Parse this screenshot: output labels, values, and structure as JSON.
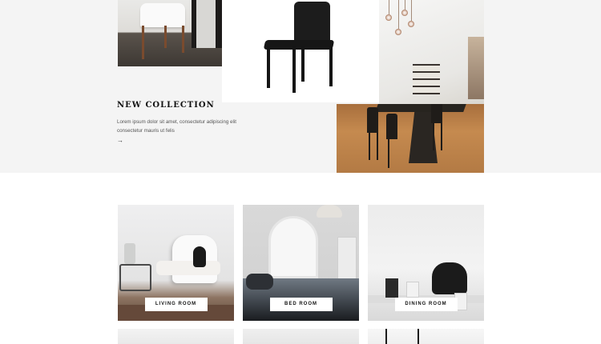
{
  "hero": {
    "title": "NEW COLLECTION",
    "description": "Lorem ipsum dolor sit amet, consectetur adipiscing elit consectetur mauris ut felis",
    "arrow": "→"
  },
  "categories": [
    {
      "label": "LIVING ROOM"
    },
    {
      "label": "BED ROOM"
    },
    {
      "label": "DINING ROOM"
    }
  ],
  "colors": {
    "hero_background": "#f4f4f4",
    "page_background": "#ffffff",
    "button_background": "#ffffff",
    "text_dark": "#111111"
  }
}
